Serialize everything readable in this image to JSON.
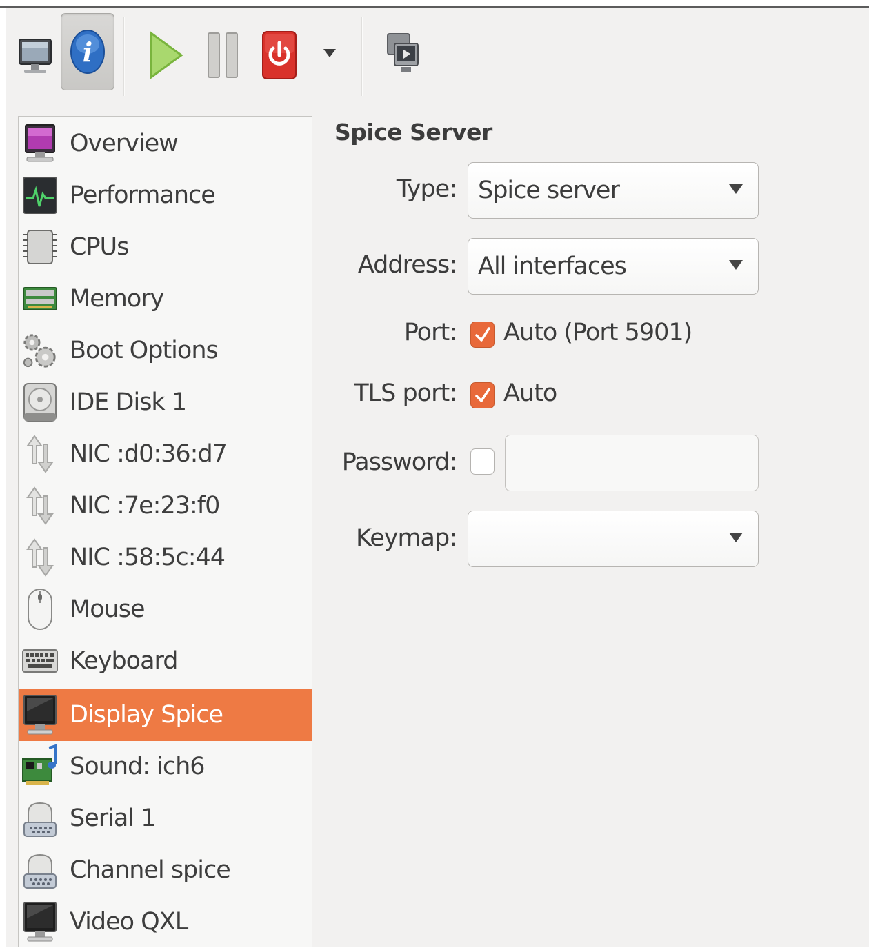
{
  "toolbar": {
    "buttons": [
      {
        "name": "console",
        "icon": "monitor-icon",
        "active": false
      },
      {
        "name": "details",
        "icon": "info-icon",
        "active": true
      },
      {
        "name": "run",
        "icon": "play-icon",
        "active": false
      },
      {
        "name": "pause",
        "icon": "pause-icon",
        "active": false
      },
      {
        "name": "shutdown",
        "icon": "power-icon",
        "active": false
      },
      {
        "name": "shutdown-menu",
        "icon": "chevron-down-icon",
        "active": false
      },
      {
        "name": "fullscreen",
        "icon": "fullscreen-icon",
        "active": false
      }
    ]
  },
  "sidebar": {
    "items": [
      {
        "label": "Overview",
        "icon": "overview-monitor-icon"
      },
      {
        "label": "Performance",
        "icon": "performance-graph-icon"
      },
      {
        "label": "CPUs",
        "icon": "cpu-chip-icon"
      },
      {
        "label": "Memory",
        "icon": "memory-module-icon"
      },
      {
        "label": "Boot Options",
        "icon": "gears-icon"
      },
      {
        "label": "IDE Disk 1",
        "icon": "hard-disk-icon"
      },
      {
        "label": "NIC :d0:36:d7",
        "icon": "network-arrows-icon"
      },
      {
        "label": "NIC :7e:23:f0",
        "icon": "network-arrows-icon"
      },
      {
        "label": "NIC :58:5c:44",
        "icon": "network-arrows-icon"
      },
      {
        "label": "Mouse",
        "icon": "mouse-icon"
      },
      {
        "label": "Keyboard",
        "icon": "keyboard-icon"
      },
      {
        "label": "Display Spice",
        "icon": "display-monitor-icon",
        "selected": true
      },
      {
        "label": "Sound: ich6",
        "icon": "sound-card-icon"
      },
      {
        "label": "Serial 1",
        "icon": "serial-port-icon"
      },
      {
        "label": "Channel spice",
        "icon": "serial-port-icon"
      },
      {
        "label": "Video QXL",
        "icon": "display-monitor-icon"
      }
    ]
  },
  "main": {
    "section_title": "Spice Server",
    "type": {
      "label": "Type:",
      "value": "Spice server"
    },
    "address": {
      "label": "Address:",
      "value": "All interfaces"
    },
    "port": {
      "label": "Port:",
      "checked": true,
      "text": "Auto (Port 5901)"
    },
    "tls_port": {
      "label": "TLS port:",
      "checked": true,
      "text": "Auto"
    },
    "password": {
      "label": "Password:",
      "checked": false,
      "value": ""
    },
    "keymap": {
      "label": "Keymap:",
      "value": ""
    }
  },
  "colors": {
    "accent": "#ee7a44",
    "checkbox_checked": "#e8693a",
    "window_bg": "#f2f1f0"
  }
}
